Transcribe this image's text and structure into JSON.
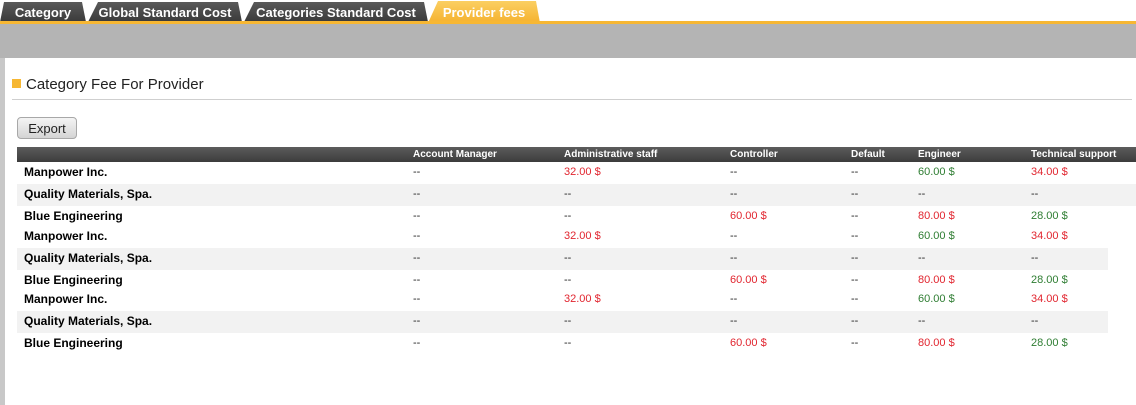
{
  "tabs": [
    {
      "label": "Category",
      "active": false
    },
    {
      "label": "Global Standard Cost",
      "active": false
    },
    {
      "label": "Categories Standard Cost",
      "active": false
    },
    {
      "label": "Provider fees",
      "active": true
    }
  ],
  "section": {
    "title": "Category Fee For Provider"
  },
  "toolbar": {
    "export_label": "Export"
  },
  "table": {
    "columns": [
      "",
      "Account Manager",
      "Administrative staff",
      "Controller",
      "Default",
      "Engineer",
      "Technical support"
    ],
    "rows": [
      [
        "Manpower Inc.",
        "--",
        "32.00 $",
        "--",
        "--",
        "60.00 $",
        "34.00 $"
      ],
      [
        "Quality Materials, Spa.",
        "--",
        "--",
        "--",
        "--",
        "--",
        "--"
      ],
      [
        "Blue Engineering",
        "--",
        "--",
        "60.00 $",
        "--",
        "80.00 $",
        "28.00 $"
      ],
      [
        "Manpower Inc.",
        "--",
        "32.00 $",
        "--",
        "--",
        "60.00 $",
        "34.00 $"
      ],
      [
        "Quality Materials, Spa.",
        "--",
        "--",
        "--",
        "--",
        "--",
        "--"
      ],
      [
        "Blue Engineering",
        "--",
        "--",
        "60.00 $",
        "--",
        "80.00 $",
        "28.00 $"
      ],
      [
        "Manpower Inc.",
        "--",
        "32.00 $",
        "--",
        "--",
        "60.00 $",
        "34.00 $"
      ],
      [
        "Quality Materials, Spa.",
        "--",
        "--",
        "--",
        "--",
        "--",
        "--"
      ],
      [
        "Blue Engineering",
        "--",
        "--",
        "60.00 $",
        "--",
        "80.00 $",
        "28.00 $"
      ]
    ]
  },
  "colors": {
    "accent": "#f6b733",
    "negative_value": "#e1252f",
    "positive_value": "#2e7d32"
  }
}
